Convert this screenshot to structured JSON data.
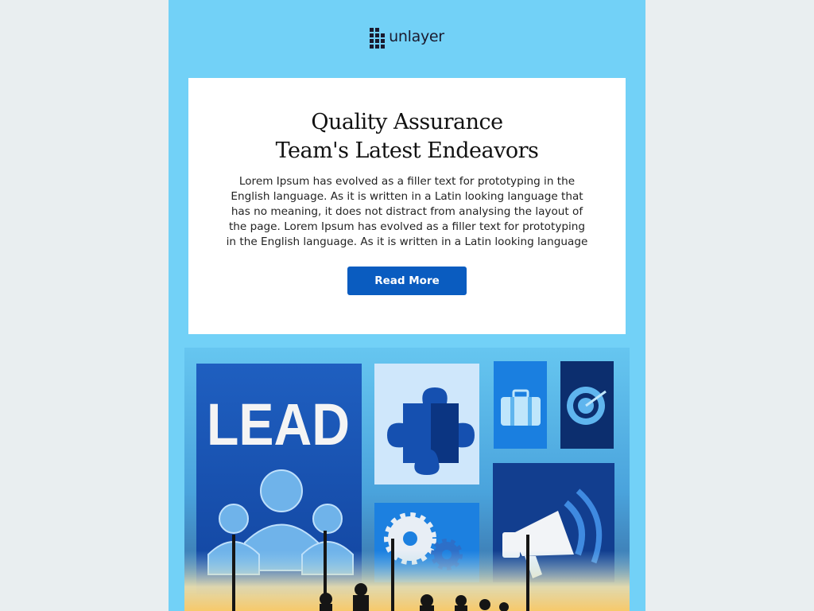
{
  "brand": {
    "name": "unlayer",
    "logo_icon": "unlayer-logo-icon"
  },
  "card": {
    "title_line1": "Quality Assurance",
    "title_line2": "Team's Latest Endeavors",
    "body": "Lorem Ipsum has evolved as a filler text for prototyping in the English language. As it is written in a Latin looking language that has no meaning, it does not distract from analysing the layout of the page. Lorem Ipsum has evolved as a filler text for prototyping in the English language. As it is written in a Latin looking language",
    "button_label": "Read More"
  },
  "hero": {
    "lead_text": "LEAD"
  },
  "colors": {
    "page_bg": "#e9eef0",
    "email_bg": "#72d1f7",
    "card_bg": "#ffffff",
    "button_bg": "#0a5cc0",
    "title_color": "#111111"
  }
}
